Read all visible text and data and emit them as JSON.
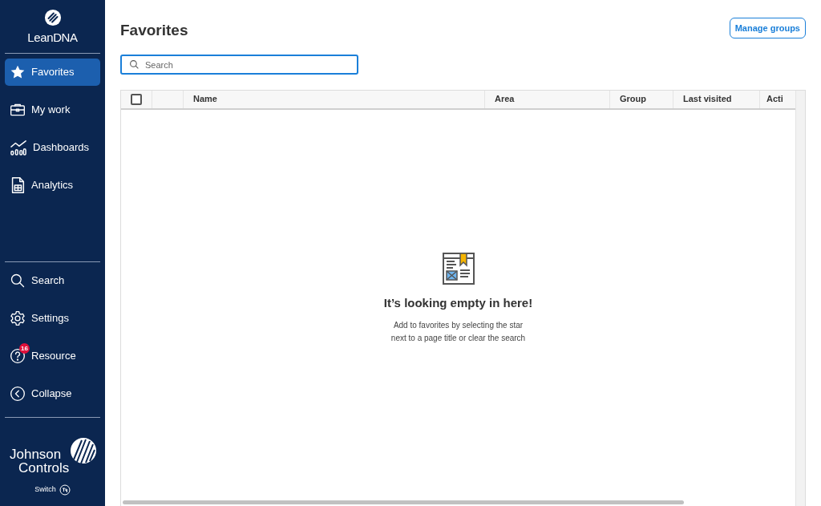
{
  "sidebar": {
    "brand": "LeanDNA",
    "nav_items": [
      {
        "label": "Favorites",
        "selected": true
      },
      {
        "label": "My work",
        "selected": false
      },
      {
        "label": "Dashboards",
        "selected": false
      },
      {
        "label": "Analytics",
        "selected": false
      }
    ],
    "bottom_items": [
      {
        "label": "Search"
      },
      {
        "label": "Settings"
      },
      {
        "label": "Resource",
        "badge": "16"
      },
      {
        "label": "Collapse"
      }
    ],
    "company_logo": [
      "Johnson",
      "Controls"
    ],
    "switch_label": "Switch"
  },
  "page": {
    "title": "Favorites",
    "manage_button": "Manage groups",
    "search": {
      "placeholder": "Search"
    }
  },
  "table": {
    "select_all_checked": false,
    "columns": [
      "Name",
      "Area",
      "Group",
      "Last visited",
      "Acti"
    ],
    "empty_state": {
      "title": "It’s looking empty in here!",
      "message": "Add to favorites by selecting the star next to a page title or clear the search"
    }
  }
}
